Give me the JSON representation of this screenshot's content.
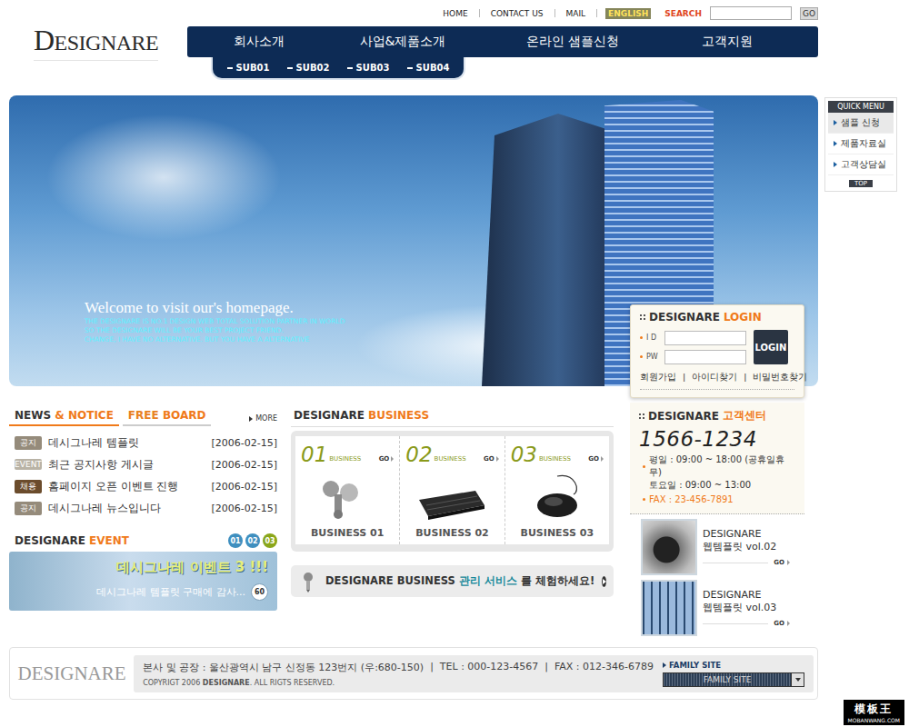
{
  "logo": {
    "text": "DESIGNARE"
  },
  "top_links": [
    {
      "label": "HOME",
      "selected": false
    },
    {
      "label": "CONTACT US",
      "selected": false
    },
    {
      "label": "MAIL",
      "selected": false
    },
    {
      "label": "ENGLISH",
      "selected": true
    }
  ],
  "search": {
    "label": "SEARCH",
    "button": "GO"
  },
  "nav": [
    {
      "label": "회사소개"
    },
    {
      "label": "사업&제품소개"
    },
    {
      "label": "온라인 샘플신청"
    },
    {
      "label": "고객지원"
    }
  ],
  "subnav": [
    "SUB01",
    "SUB02",
    "SUB03",
    "SUB04"
  ],
  "banner": {
    "title": "Welcome to visit our's homepage.",
    "lines": [
      "THE DESIGNARE IS NO.1 DESIGN WEB TOTAL SOLUTION PARTNER IN WORLD",
      "SO  THE DESIGNARE WILL BE YOUR BEST PROJECT FRIEND.",
      "CHANGE, I HAVE NO ALTERNATIVE. BUT YOU HAVE A ALTERNATIVE"
    ]
  },
  "quick_menu": {
    "title": "QUICK MENU",
    "items": [
      {
        "label": "샘플 신청",
        "selected": true
      },
      {
        "label": "제품자료실",
        "selected": false
      },
      {
        "label": "고객상담실",
        "selected": false
      }
    ],
    "top": "TOP"
  },
  "login": {
    "title_a": "DESIGNARE",
    "title_b": "LOGIN",
    "id_label": "I D",
    "pw_label": "PW",
    "button": "LOGIN",
    "separator": "|",
    "links": [
      "회원가입",
      "아이디찾기",
      "비밀번호찾기"
    ]
  },
  "customer_center": {
    "title_a": "DESIGNARE",
    "title_b": "고객센터",
    "phone": "1566-1234",
    "hours": [
      "평일 : 09:00 ~ 18:00 (공휴일휴무)",
      "토요일 : 09:00 ~ 13:00"
    ],
    "fax": "FAX : 23-456-7891"
  },
  "templates": [
    {
      "brand": "DESIGNARE",
      "title": "웹템플릿 vol.02",
      "go": "GO"
    },
    {
      "brand": "DESIGNARE",
      "title": "웹템플릿 vol.03",
      "go": "GO"
    }
  ],
  "news": {
    "tabs": [
      {
        "label_a": "NEWS",
        "label_b": "& NOTICE",
        "selected": true
      },
      {
        "label_a": "FREE",
        "label_b": "BOARD",
        "selected": false
      }
    ],
    "more": "MORE",
    "rows": [
      {
        "badge": "공지",
        "color": "#958b7b",
        "title": "데시그나레 템플릿",
        "date": "[2006-02-15]"
      },
      {
        "badge": "EVENT",
        "color": "#b9b3a6",
        "title": "최근 공지사항 게시글",
        "date": "[2006-02-15]"
      },
      {
        "badge": "채용",
        "color": "#6b4c2c",
        "title": "홈페이지 오픈 이벤트 진행",
        "date": "[2006-02-15]"
      },
      {
        "badge": "공지",
        "color": "#958b7b",
        "title": "데시그나레 뉴스입니다",
        "date": "[2006-02-15]"
      }
    ]
  },
  "event": {
    "title_a": "DESIGNARE",
    "title_b": "EVENT",
    "pages": [
      {
        "label": "01",
        "selected": false
      },
      {
        "label": "02",
        "selected": false
      },
      {
        "label": "03",
        "selected": true
      }
    ],
    "banner_title": "데시그나레 이벤트 3 !!!",
    "banner_text": "데시그나레 템플릿 구매에 감사...",
    "badge": "60"
  },
  "business": {
    "title_a": "DESIGNARE",
    "title_b": "BUSINESS",
    "cards": [
      {
        "num": "01",
        "sub": "BUSINESS",
        "go": "GO",
        "label": "BUSINESS 01"
      },
      {
        "num": "02",
        "sub": "BUSINESS",
        "go": "GO",
        "label": "BUSINESS 02"
      },
      {
        "num": "03",
        "sub": "BUSINESS",
        "go": "GO",
        "label": "BUSINESS 03"
      }
    ]
  },
  "promo": {
    "a": "DESIGNARE BUSINESS",
    "b": "관리 서비스",
    "c": "를 체험하세요!"
  },
  "footer": {
    "logo": "DESIGNARE",
    "address": "본사 및 공장 : 울산광역시 남구 신정동 123번지 (우:680-150)",
    "separator": "|",
    "tel": "TEL : 000-123-4567",
    "fax": "FAX : 012-346-6789",
    "copyright_a": "COPYRIGT 2006",
    "copyright_b": "DESIGNARE",
    "copyright_c": ". ALL RIGTS RESERVED.",
    "family_label": "FAMILY SITE",
    "family_select": "FAMILY SITE"
  },
  "watermark": {
    "text": "模板王",
    "url": "MOBANWANG.COM"
  }
}
